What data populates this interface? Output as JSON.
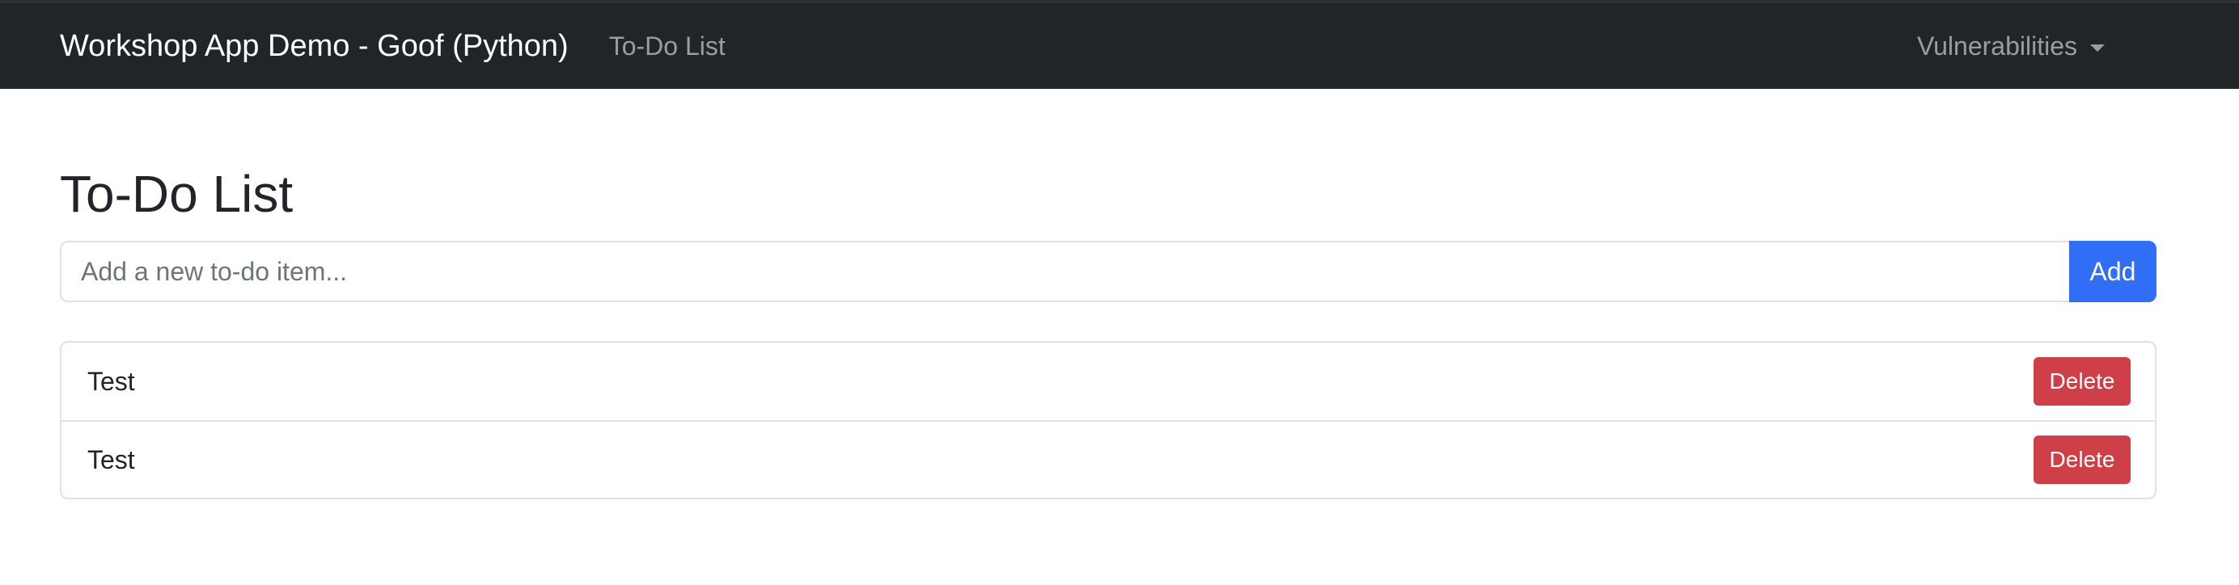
{
  "navbar": {
    "brand": "Workshop App Demo - Goof (Python)",
    "link": "To-Do List",
    "dropdown": "Vulnerabilities"
  },
  "main": {
    "title": "To-Do List",
    "input_placeholder": "Add a new to-do item...",
    "input_value": "",
    "add_label": "Add"
  },
  "todos": [
    {
      "text": "Test",
      "delete_label": "Delete"
    },
    {
      "text": "Test",
      "delete_label": "Delete"
    }
  ],
  "colors": {
    "navbar_bg": "#212529",
    "primary": "#2f6ef5",
    "danger": "#cf3f47"
  }
}
